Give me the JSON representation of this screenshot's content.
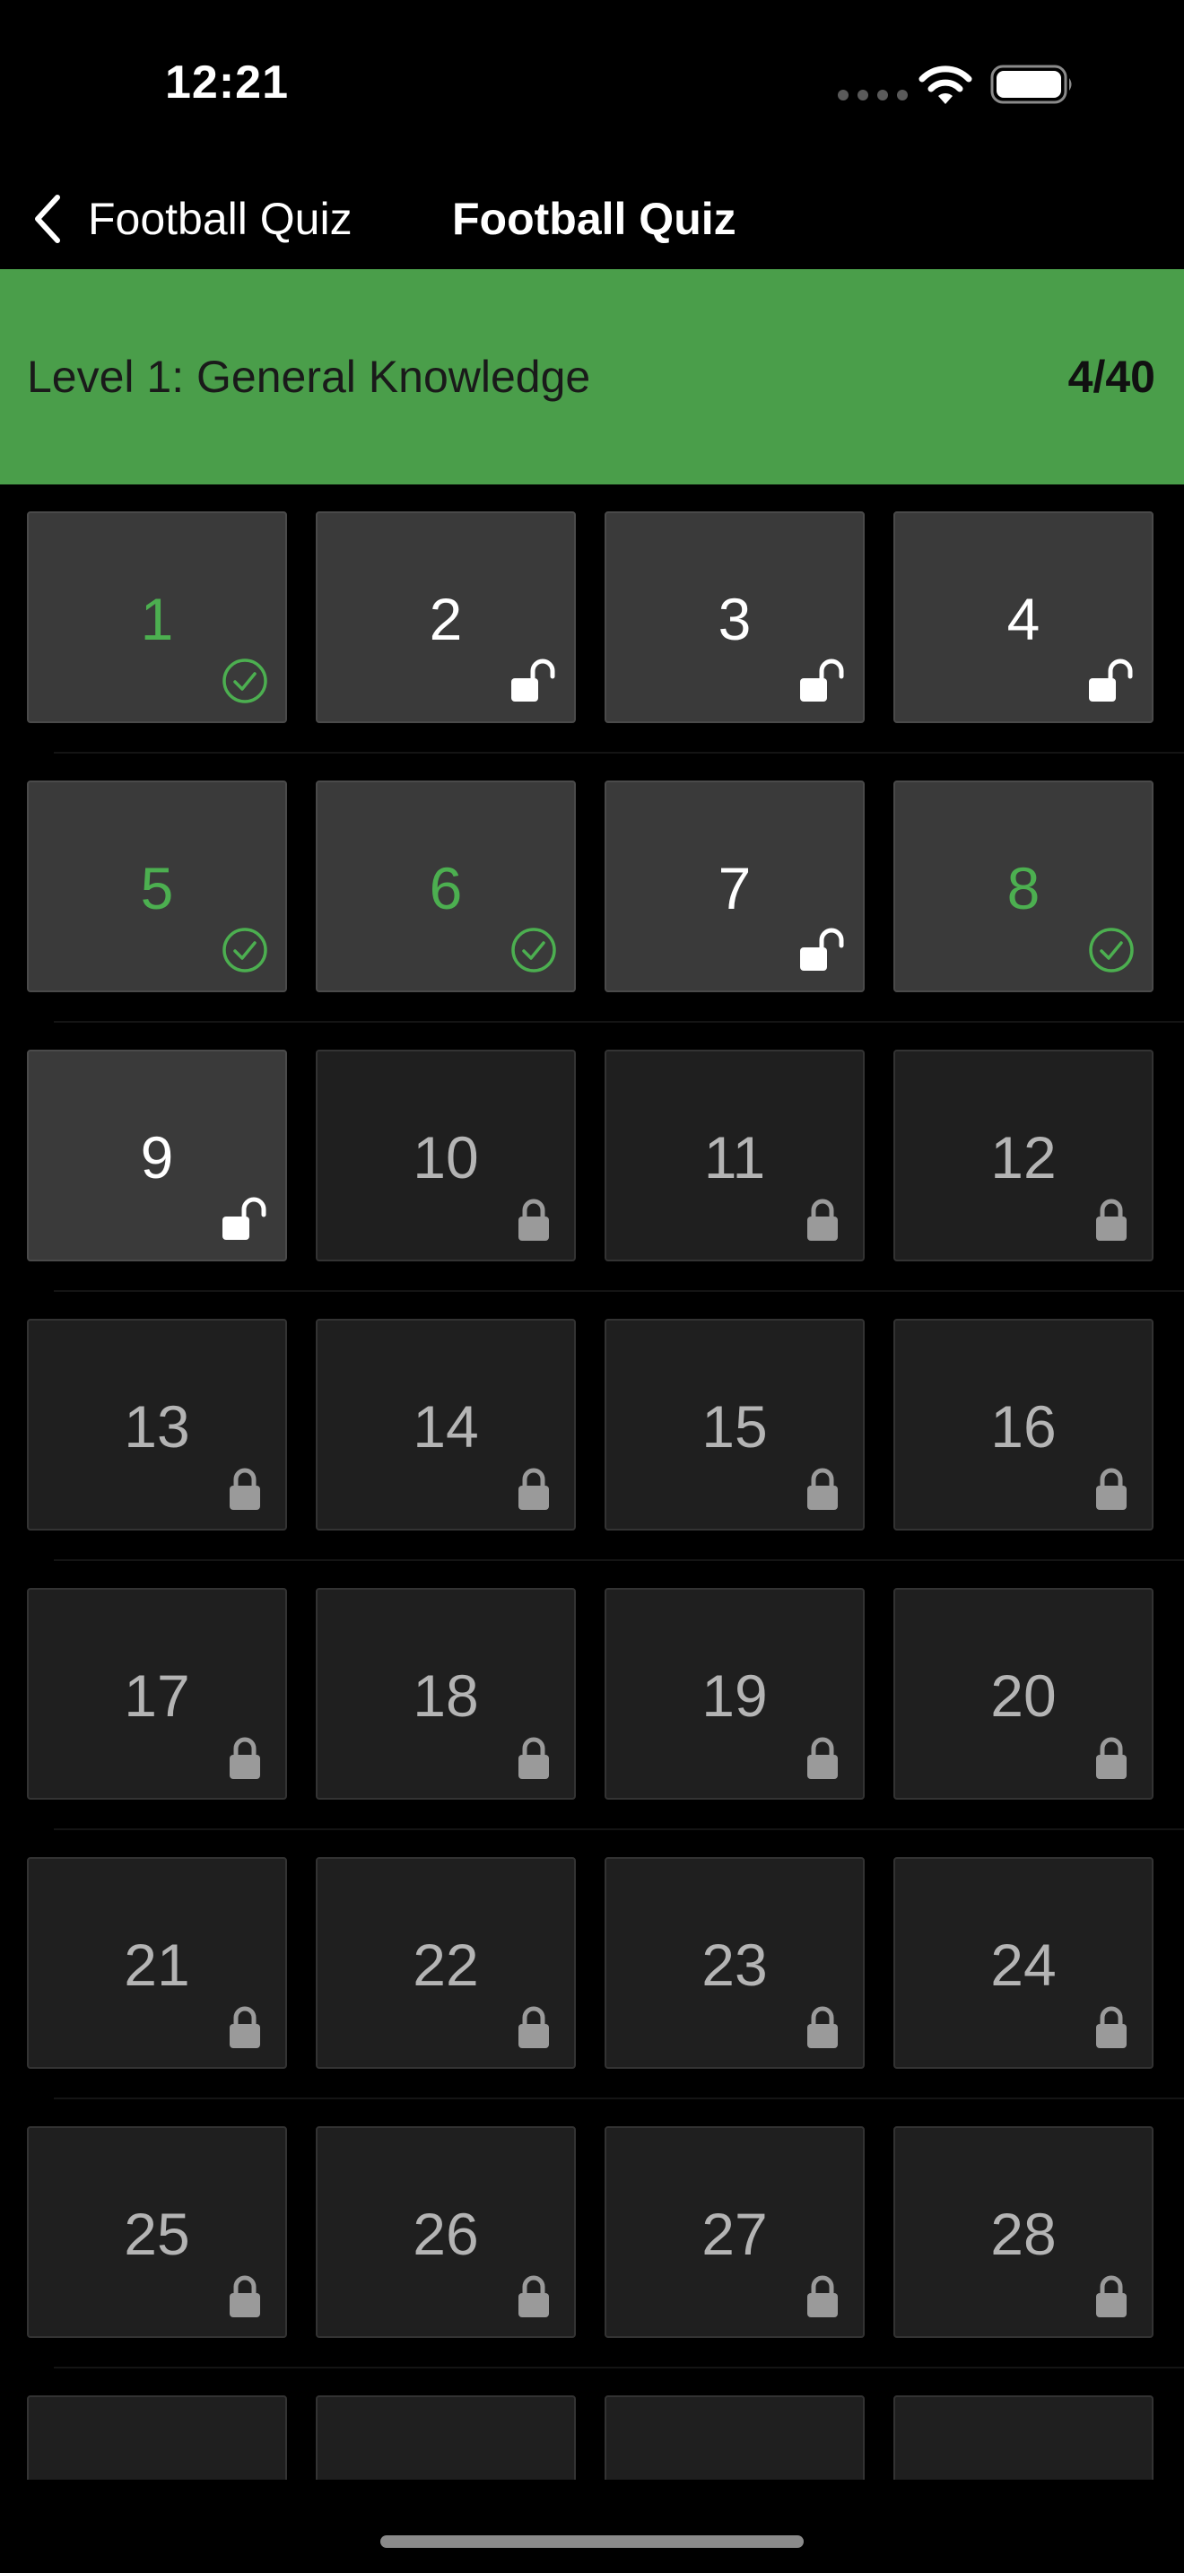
{
  "status_bar": {
    "time": "12:21"
  },
  "nav": {
    "back_label": "Football Quiz",
    "title": "Football Quiz"
  },
  "level": {
    "title": "Level 1: General Knowledge",
    "progress": "4/40"
  },
  "colors": {
    "accent_green": "#4caf50",
    "header_green": "#4a9e4a",
    "tile_open": "#3a3a3a",
    "tile_locked": "#1f1f1f"
  },
  "tiles": [
    {
      "number": "1",
      "state": "completed",
      "icon": "check-circle-icon"
    },
    {
      "number": "2",
      "state": "unlocked",
      "icon": "unlock-icon"
    },
    {
      "number": "3",
      "state": "unlocked",
      "icon": "unlock-icon"
    },
    {
      "number": "4",
      "state": "unlocked",
      "icon": "unlock-icon"
    },
    {
      "number": "5",
      "state": "completed",
      "icon": "check-circle-icon"
    },
    {
      "number": "6",
      "state": "completed",
      "icon": "check-circle-icon"
    },
    {
      "number": "7",
      "state": "unlocked",
      "icon": "unlock-icon"
    },
    {
      "number": "8",
      "state": "completed",
      "icon": "check-circle-icon"
    },
    {
      "number": "9",
      "state": "unlocked",
      "icon": "unlock-icon"
    },
    {
      "number": "10",
      "state": "locked",
      "icon": "lock-icon"
    },
    {
      "number": "11",
      "state": "locked",
      "icon": "lock-icon"
    },
    {
      "number": "12",
      "state": "locked",
      "icon": "lock-icon"
    },
    {
      "number": "13",
      "state": "locked",
      "icon": "lock-icon"
    },
    {
      "number": "14",
      "state": "locked",
      "icon": "lock-icon"
    },
    {
      "number": "15",
      "state": "locked",
      "icon": "lock-icon"
    },
    {
      "number": "16",
      "state": "locked",
      "icon": "lock-icon"
    },
    {
      "number": "17",
      "state": "locked",
      "icon": "lock-icon"
    },
    {
      "number": "18",
      "state": "locked",
      "icon": "lock-icon"
    },
    {
      "number": "19",
      "state": "locked",
      "icon": "lock-icon"
    },
    {
      "number": "20",
      "state": "locked",
      "icon": "lock-icon"
    },
    {
      "number": "21",
      "state": "locked",
      "icon": "lock-icon"
    },
    {
      "number": "22",
      "state": "locked",
      "icon": "lock-icon"
    },
    {
      "number": "23",
      "state": "locked",
      "icon": "lock-icon"
    },
    {
      "number": "24",
      "state": "locked",
      "icon": "lock-icon"
    },
    {
      "number": "25",
      "state": "locked",
      "icon": "lock-icon"
    },
    {
      "number": "26",
      "state": "locked",
      "icon": "lock-icon"
    },
    {
      "number": "27",
      "state": "locked",
      "icon": "lock-icon"
    },
    {
      "number": "28",
      "state": "locked",
      "icon": "lock-icon"
    },
    {
      "number": "",
      "state": "locked",
      "icon": ""
    },
    {
      "number": "",
      "state": "locked",
      "icon": ""
    },
    {
      "number": "",
      "state": "locked",
      "icon": ""
    },
    {
      "number": "",
      "state": "locked",
      "icon": ""
    }
  ]
}
